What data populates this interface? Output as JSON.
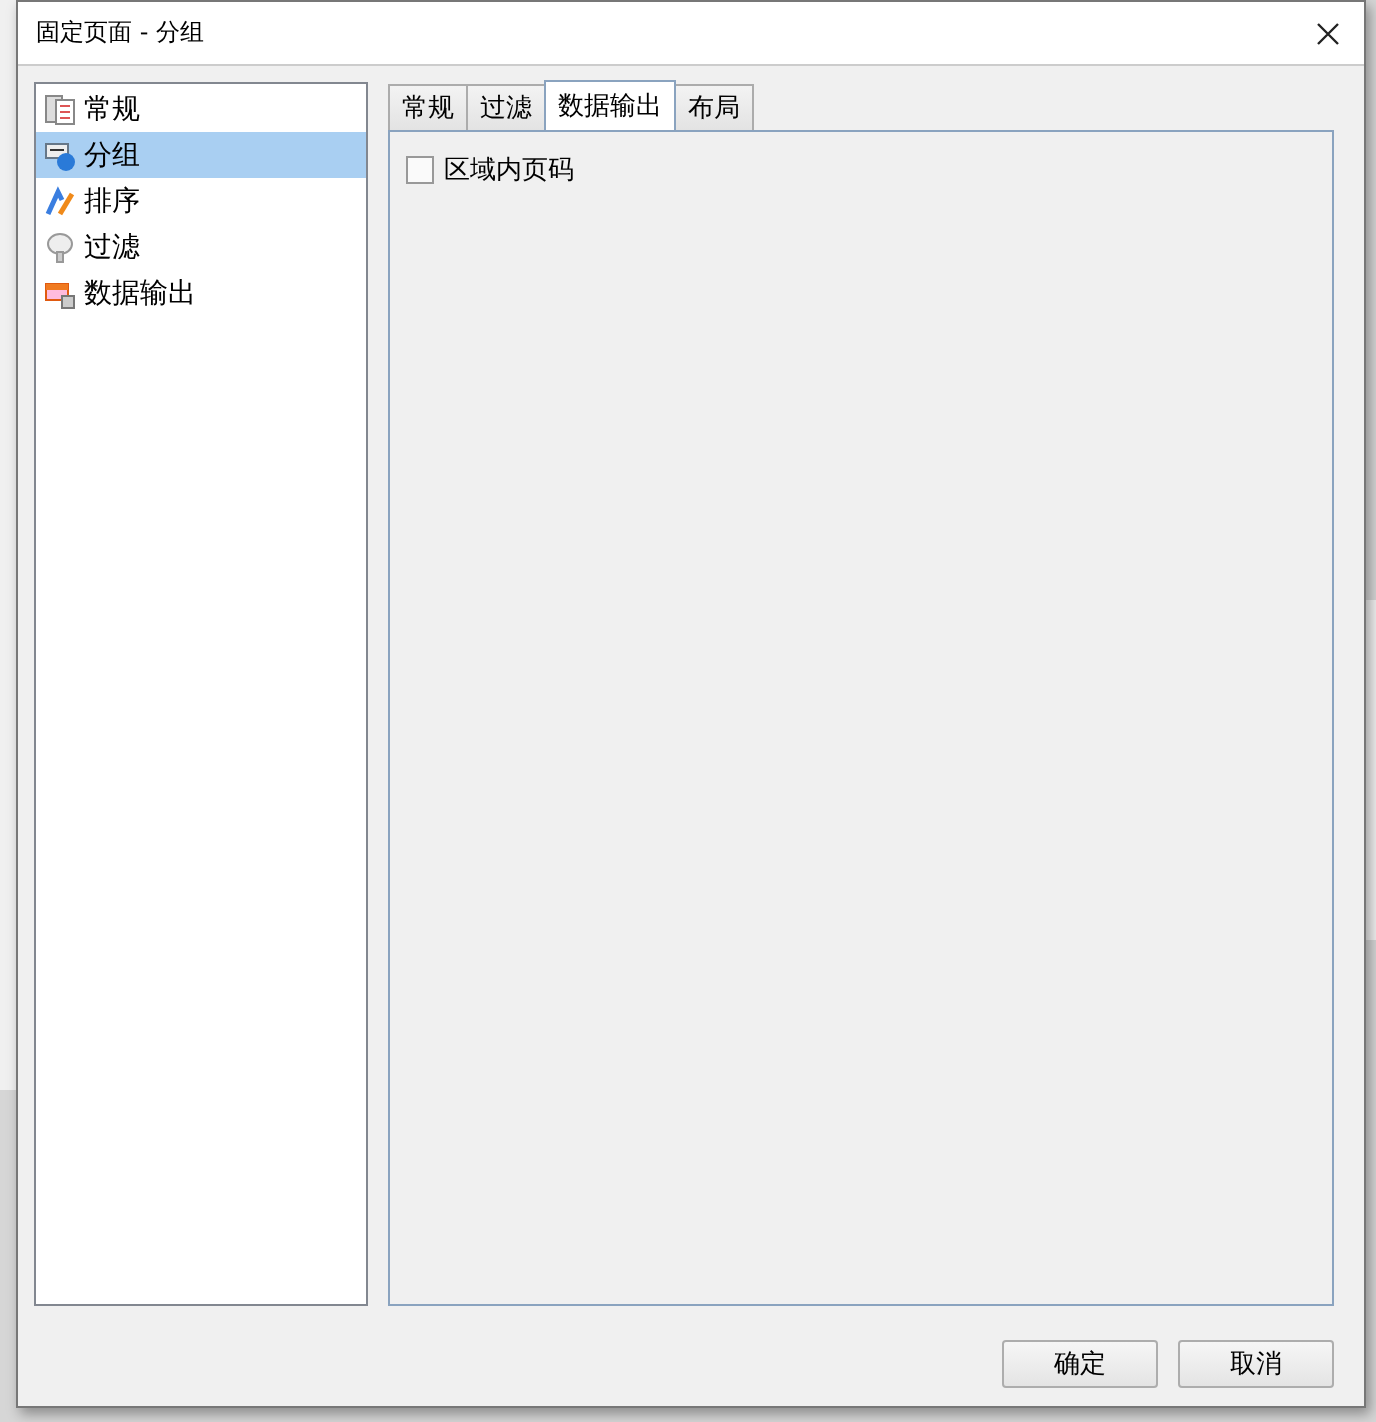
{
  "window": {
    "title": "固定页面 - 分组"
  },
  "sidebar": {
    "items": [
      {
        "label": "常规",
        "selected": false
      },
      {
        "label": "分组",
        "selected": true
      },
      {
        "label": "排序",
        "selected": false
      },
      {
        "label": "过滤",
        "selected": false
      },
      {
        "label": "数据输出",
        "selected": false
      }
    ]
  },
  "tabs": [
    {
      "label": "常规",
      "selected": false
    },
    {
      "label": "过滤",
      "selected": false
    },
    {
      "label": "数据输出",
      "selected": true
    },
    {
      "label": "布局",
      "selected": false
    }
  ],
  "options": [
    {
      "label": "区域内页码",
      "checked": false
    }
  ],
  "buttons": [
    "确定",
    "取消"
  ]
}
